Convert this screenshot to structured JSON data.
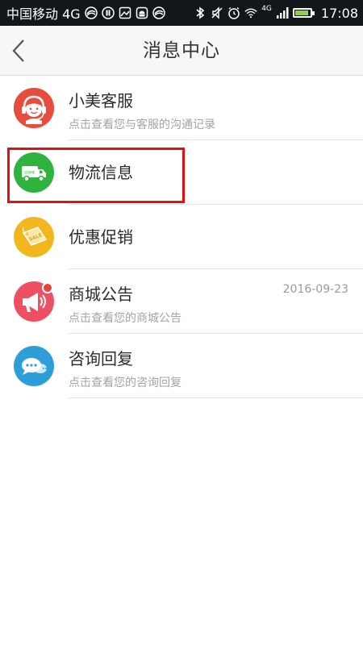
{
  "status_bar": {
    "carrier": "中国移动 4G",
    "network_badge": "4G",
    "time": "17:08",
    "icons": [
      "signal-swirl-icon",
      "sync-icon",
      "image-icon",
      "android-icon",
      "signal-swirl-icon",
      "bluetooth-icon",
      "mute-icon",
      "alarm-icon",
      "wifi-icon",
      "cell-signal-icon",
      "battery-icon"
    ]
  },
  "header": {
    "title": "消息中心",
    "back_icon": "chevron-left-icon"
  },
  "messages": [
    {
      "title": "小美客服",
      "subtitle": "点击查看您与客服的沟通记录",
      "date": "",
      "icon": "customer-service-icon",
      "color": "#e84c3d",
      "has_badge": false
    },
    {
      "title": "物流信息",
      "subtitle": "",
      "date": "",
      "icon": "truck-icon",
      "color": "#2fb33f",
      "has_badge": false,
      "highlighted": true
    },
    {
      "title": "优惠促销",
      "subtitle": "",
      "date": "",
      "icon": "sale-tag-icon",
      "color": "#f2b71c",
      "has_badge": false
    },
    {
      "title": "商城公告",
      "subtitle": "点击查看您的商城公告",
      "date": "2016-09-23",
      "icon": "megaphone-icon",
      "color": "#ef4f63",
      "has_badge": true
    },
    {
      "title": "咨询回复",
      "subtitle": "点击查看您的咨询回复",
      "date": "",
      "icon": "chat-bubble-icon",
      "color": "#2d9ed8",
      "has_badge": false
    }
  ],
  "icon_text": {
    "truck_label": "DOME",
    "sale_label": "SALE"
  },
  "colors": {
    "status_bar_bg": "#12171c",
    "header_bg": "#f7f7f7",
    "highlight": "#e40f0f"
  }
}
